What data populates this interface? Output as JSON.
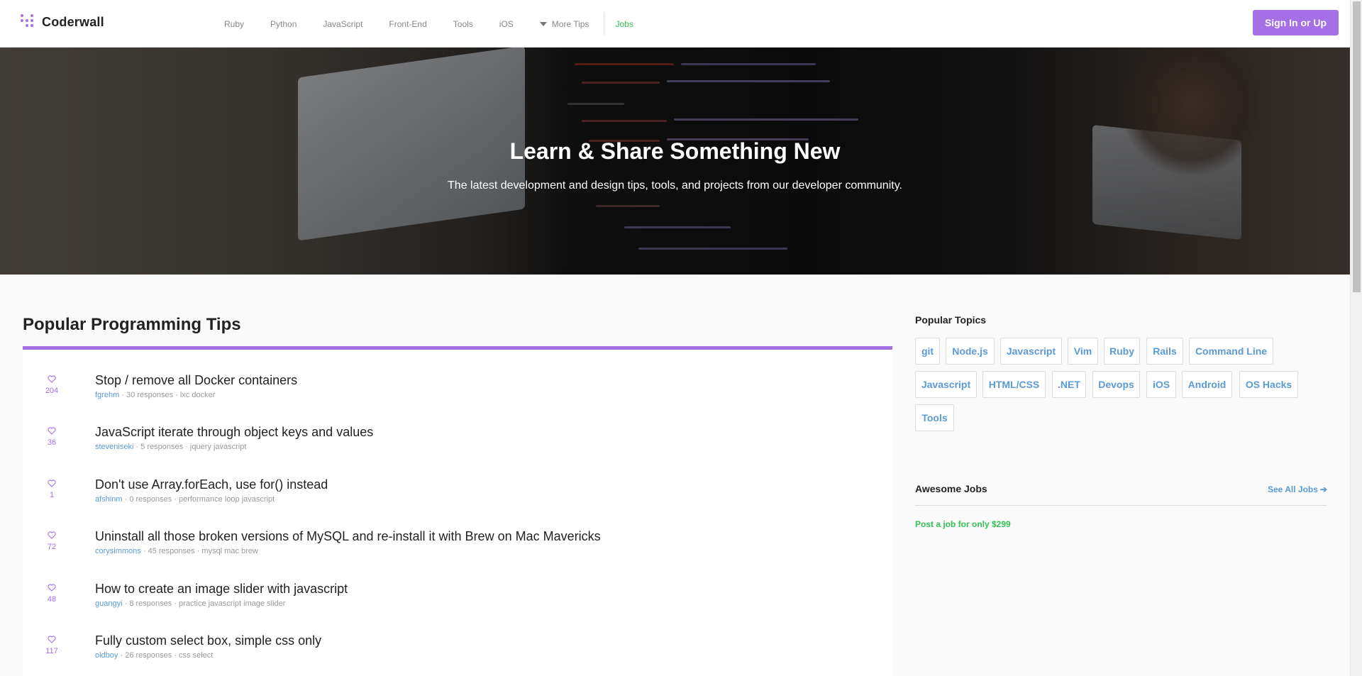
{
  "header": {
    "logo_text": "Coderwall",
    "nav": [
      "Ruby",
      "Python",
      "JavaScript",
      "Front-End",
      "Tools",
      "iOS"
    ],
    "more_tips": "More Tips",
    "jobs": "Jobs",
    "signin": "Sign In or Up"
  },
  "hero": {
    "title": "Learn & Share Something New",
    "subtitle": "The latest development and design tips, tools, and projects from our developer community."
  },
  "main": {
    "title": "Popular Programming Tips",
    "tips": [
      {
        "votes": "204",
        "title": "Stop / remove all Docker containers",
        "author": "fgrehm",
        "responses": "30 responses",
        "tags": "lxc docker"
      },
      {
        "votes": "36",
        "title": "JavaScript iterate through object keys and values",
        "author": "steveniseki",
        "responses": "5 responses",
        "tags": "jquery javascript"
      },
      {
        "votes": "1",
        "title": "Don't use Array.forEach, use for() instead",
        "author": "afshinm",
        "responses": "0 responses",
        "tags": "performance loop javascript"
      },
      {
        "votes": "72",
        "title": "Uninstall all those broken versions of MySQL and re-install it with Brew on Mac Mavericks",
        "author": "corysimmons",
        "responses": "45 responses",
        "tags": "mysql mac brew"
      },
      {
        "votes": "48",
        "title": "How to create an image slider with javascript",
        "author": "guangyi",
        "responses": "8 responses",
        "tags": "practice javascript image slider"
      },
      {
        "votes": "117",
        "title": "Fully custom select box, simple css only",
        "author": "oldboy",
        "responses": "26 responses",
        "tags": "css select"
      }
    ]
  },
  "sidebar": {
    "popular_topics_title": "Popular Topics",
    "topics": [
      "git",
      "Node.js",
      "Javascript",
      "Vim",
      "Ruby",
      "Rails",
      "Command Line",
      "Javascript",
      "HTML/CSS",
      ".NET",
      "Devops",
      "iOS",
      "Android",
      "OS Hacks",
      "Tools"
    ],
    "jobs_title": "Awesome Jobs",
    "see_all": "See All Jobs",
    "post_job": "Post a job for only $299"
  },
  "colors": {
    "accent": "#a56fe6",
    "link": "#5b9bd5",
    "jobs_green": "#36c156"
  }
}
